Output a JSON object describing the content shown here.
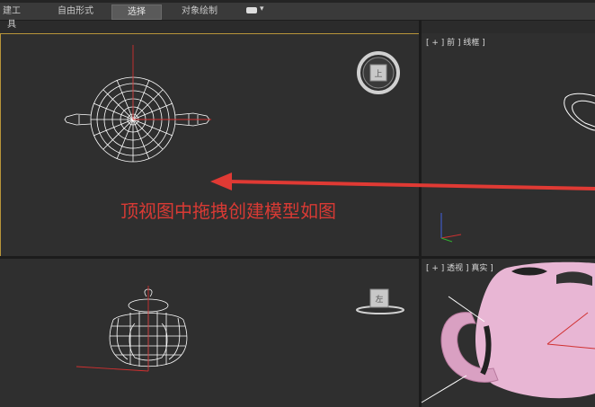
{
  "ribbon": {
    "tabs": [
      {
        "label": "建工具",
        "active": false
      },
      {
        "label": "自由形式",
        "active": false
      },
      {
        "label": "选择",
        "active": true
      },
      {
        "label": "对象绘制",
        "active": false
      }
    ],
    "dropdown_arrow": "▾"
  },
  "viewports": {
    "top": {
      "label": "",
      "viewcube_label": "上",
      "active": true
    },
    "front": {
      "label": "[ + ] 前 ] 线框 ]"
    },
    "left": {
      "label": "",
      "viewcube_label": "左"
    },
    "perspective": {
      "label": "[ + ] 透视 ] 真实 ]"
    }
  },
  "annotation": {
    "text": "顶视图中拖拽创建模型如图",
    "color": "#d83a34"
  },
  "colors": {
    "background": "#2f2f2f",
    "active_border": "#b8953a",
    "wireframe": "#ffffff",
    "teapot_shaded": "#e8b6d4",
    "axis_x": "#d03030",
    "axis_y": "#30b030",
    "axis_z": "#4060e0"
  }
}
